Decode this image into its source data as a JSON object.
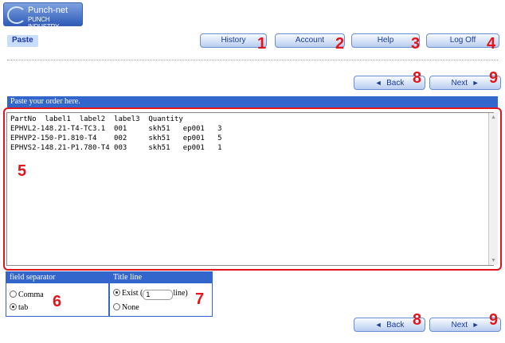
{
  "header": {
    "logo_line1": "Punch-net",
    "logo_line2": "PUNCH INDUSTRY"
  },
  "nav": {
    "page_label": "Paste",
    "buttons": [
      {
        "label": "History",
        "marker": "1"
      },
      {
        "label": "Account",
        "marker": "2"
      },
      {
        "label": "Help",
        "marker": "3"
      },
      {
        "label": "Log Off",
        "marker": "4"
      }
    ]
  },
  "pager": {
    "back_label": "Back",
    "next_label": "Next",
    "back_marker": "8",
    "next_marker": "9"
  },
  "paste_section": {
    "title": "Paste your order here.",
    "marker": "5",
    "content": "PartNo  label1  label2  label3  Quantity\nEPHVL2-148.21-T4-TC3.1  001     skh51   ep001   3\nEPHVP2-150-P1.810-T4    002     skh51   ep001   5\nEPHVS2-148.21-P1.780-T4 003     skh51   ep001   1"
  },
  "field_separator": {
    "title": "field separator",
    "options": [
      "Comma",
      "tab"
    ],
    "selected": "tab",
    "marker": "6"
  },
  "title_line": {
    "title": "Title line",
    "exist_label": "Exist (",
    "line_value": "1",
    "line_suffix": "line)",
    "none_label": "None",
    "selected": "Exist",
    "marker": "7"
  },
  "colors": {
    "accent": "#3366cc",
    "marker_red": "#e4141c",
    "button_text": "#1a3aa0"
  }
}
